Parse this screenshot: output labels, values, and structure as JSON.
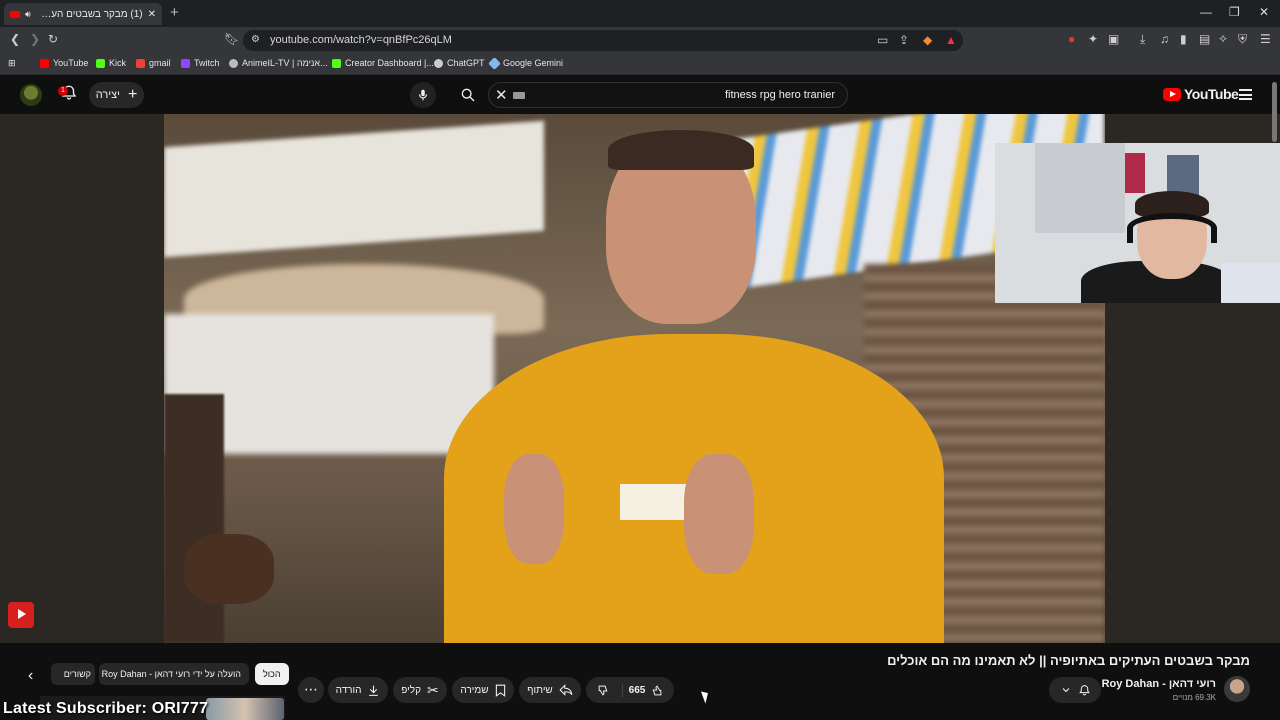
{
  "browser": {
    "tab_title": "(1) מבקר בשבטים העתיקים ב",
    "url": "youtube.com/watch?v=qnBfPc26qLM",
    "bookmarks": [
      "YouTube",
      "Kick",
      "gmail",
      "Twitch",
      "AnimeIL-TV | אנימה...",
      "Creator Dashboard |...",
      "ChatGPT",
      "Google Gemini"
    ]
  },
  "header": {
    "notification_count": "1",
    "create_label": "יצירה",
    "search_query": "fitness rpg hero tranier",
    "logo_text": "YouTube"
  },
  "video": {
    "title": "מבקר בשבטים העתיקים באתיופיה || לא תאמינו מה הם אוכלים",
    "channel_name": "רועי דהאן - Roy Dahan",
    "subscribers": "69.3K מנויים"
  },
  "actions": {
    "likes": "665",
    "share": "שיתוף",
    "save": "שמירה",
    "clip": "קליפ",
    "download": "הורדה"
  },
  "chips": {
    "all": "הכול",
    "uploaded_by": "הועלה על ידי רועי דהאן - Roy Dahan",
    "related": "קשורים"
  },
  "overlay": {
    "latest_subscriber": "Latest Subscriber: ORI777"
  },
  "colors": {
    "accent_red": "#ff0000",
    "chip_bg": "#272727",
    "page_bg": "#0f0f0f"
  }
}
